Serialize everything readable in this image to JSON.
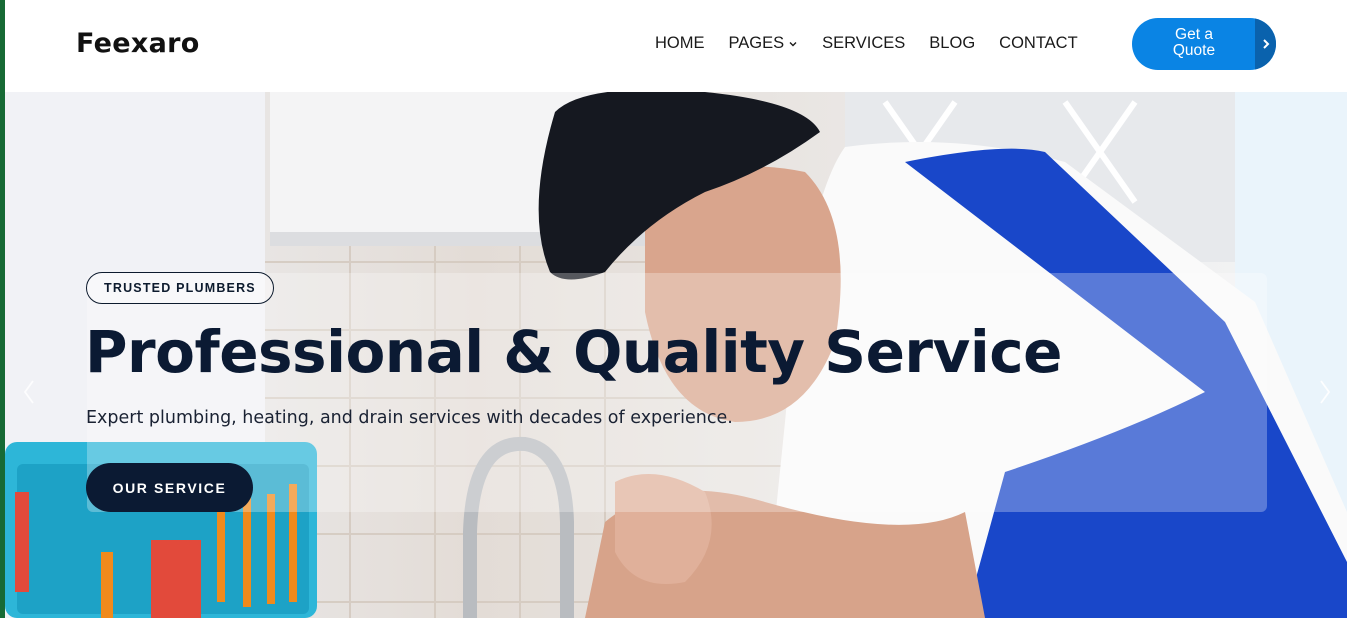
{
  "header": {
    "logo": "Feexaro",
    "nav": [
      {
        "label": "HOME"
      },
      {
        "label": "PAGES",
        "has_dropdown": true
      },
      {
        "label": "SERVICES"
      },
      {
        "label": "BLOG"
      },
      {
        "label": "CONTACT"
      }
    ],
    "cta": {
      "line1": "Get a",
      "line2": "Quote",
      "icon": "chevron-right-icon"
    }
  },
  "hero": {
    "badge": "TRUSTED PLUMBERS",
    "title": "Professional & Quality Service",
    "subtitle": "Expert plumbing, heating, and drain services with decades of experience.",
    "button": "OUR SERVICE",
    "prev_icon": "chevron-left-icon",
    "next_icon": "chevron-right-icon"
  },
  "colors": {
    "brand_blue": "#0a84e4",
    "brand_blue_dark": "#0a62ad",
    "navy": "#0b1a33",
    "left_strip": "#176a35"
  }
}
